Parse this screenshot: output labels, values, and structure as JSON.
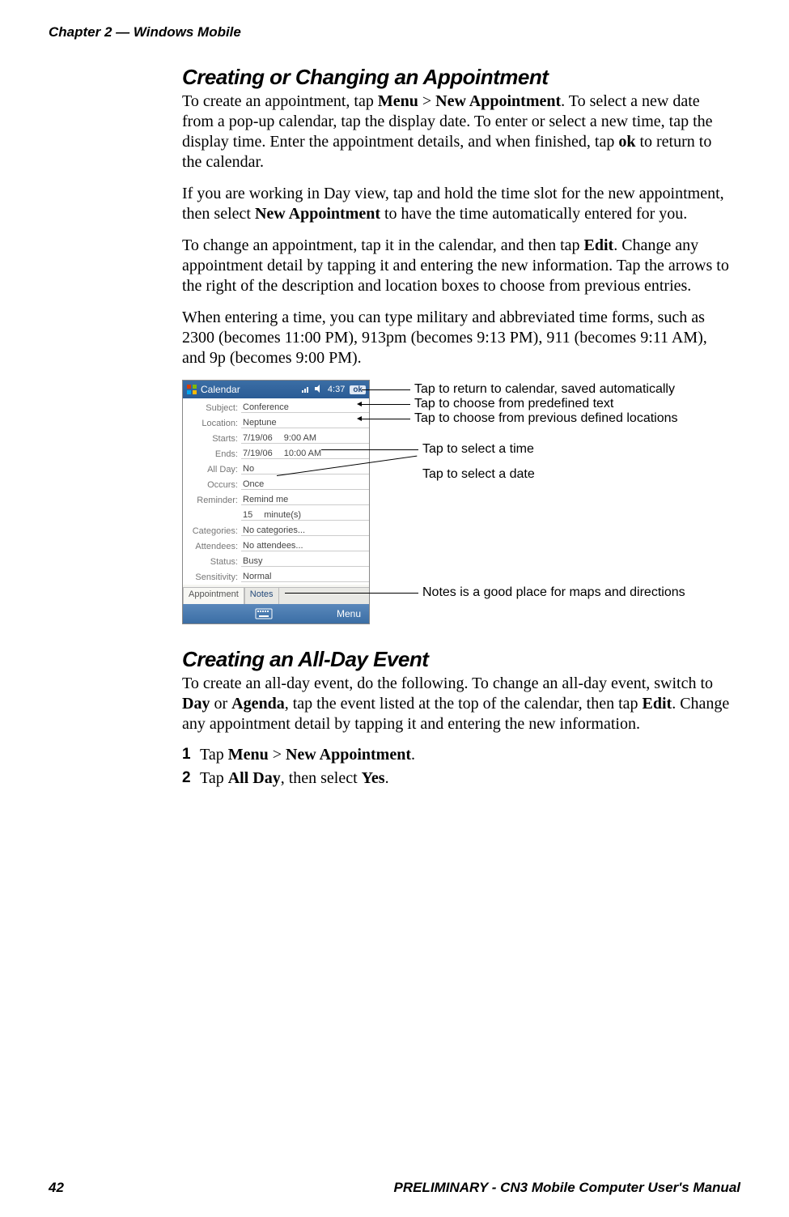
{
  "header": {
    "chapter": "Chapter 2 — Windows Mobile"
  },
  "section1": {
    "title": "Creating or Changing an Appointment",
    "p1_a": "To create an appointment, tap ",
    "p1_b": "Menu",
    "p1_c": " > ",
    "p1_d": "New Appointment",
    "p1_e": ". To select a new date from a pop-up calendar, tap the display date. To enter or select a new time, tap the display time. Enter the appointment details, and when finished, tap ",
    "p1_f": "ok",
    "p1_g": " to return to the calendar.",
    "p2_a": "If you are working in Day view, tap and hold the time slot for the new appointment, then select ",
    "p2_b": "New Appointment",
    "p2_c": " to have the time automatically entered for you.",
    "p3_a": "To change an appointment, tap it in the calendar, and then tap ",
    "p3_b": "Edit",
    "p3_c": ". Change any appointment detail by tapping it and entering the new information. Tap the arrows to the right of the description and location boxes to choose from previous entries.",
    "p4": "When entering a time, you can type military and abbreviated time forms, such as 2300 (becomes 11:00 PM), 913pm (becomes 9:13 PM), 911 (becomes 9:11 AM), and 9p (becomes 9:00 PM)."
  },
  "device": {
    "title": "Calendar",
    "time": "4:37",
    "ok": "ok",
    "rows": {
      "subject_l": "Subject:",
      "subject_v": "Conference",
      "location_l": "Location:",
      "location_v": "Neptune",
      "starts_l": "Starts:",
      "starts_d": "7/19/06",
      "starts_t": "9:00 AM",
      "ends_l": "Ends:",
      "ends_d": "7/19/06",
      "ends_t": "10:00 AM",
      "allday_l": "All Day:",
      "allday_v": "No",
      "occurs_l": "Occurs:",
      "occurs_v": "Once",
      "reminder_l": "Reminder:",
      "reminder_v": "Remind me",
      "remindertime_v": "15",
      "remindertime_u": "minute(s)",
      "categories_l": "Categories:",
      "categories_v": "No categories...",
      "attendees_l": "Attendees:",
      "attendees_v": "No attendees...",
      "status_l": "Status:",
      "status_v": "Busy",
      "sensitivity_l": "Sensitivity:",
      "sensitivity_v": "Normal"
    },
    "tab_appt": "Appointment",
    "tab_notes": "Notes",
    "menu": "Menu"
  },
  "annotations": {
    "a1": "Tap to return to calendar, saved automatically",
    "a2": "Tap to choose from predefined text",
    "a3": "Tap to choose from previous defined locations",
    "a4": "Tap to select a time",
    "a5": "Tap to select a date",
    "a6": "Notes is a good place for maps and directions"
  },
  "section2": {
    "title": "Creating an All-Day Event",
    "p1_a": "To create an all-day event, do the following. To change an all-day event, switch to ",
    "p1_b": "Day",
    "p1_c": " or ",
    "p1_d": "Agenda",
    "p1_e": ", tap the event listed at the top of the calendar, then tap ",
    "p1_f": "Edit",
    "p1_g": ". Change any appointment detail by tapping it and entering the new information.",
    "step1_a": "Tap ",
    "step1_b": "Menu",
    "step1_c": " > ",
    "step1_d": "New Appointment",
    "step1_e": ".",
    "step2_a": "Tap ",
    "step2_b": "All Day",
    "step2_c": ", then select ",
    "step2_d": "Yes",
    "step2_e": "."
  },
  "footer": {
    "page": "42",
    "doc": "PRELIMINARY - CN3 Mobile Computer User's Manual"
  }
}
